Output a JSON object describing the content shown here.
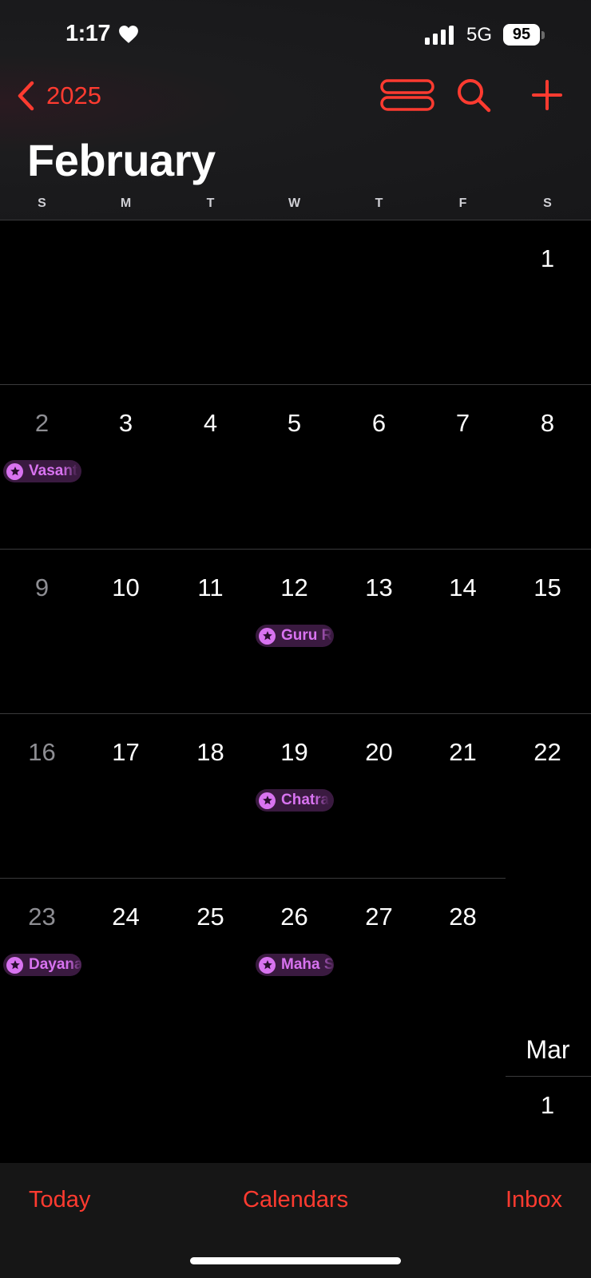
{
  "status_bar": {
    "time": "1:17",
    "network": "5G",
    "battery": "95"
  },
  "nav": {
    "back_label": "2025"
  },
  "month_title": "February",
  "weekdays": [
    "S",
    "M",
    "T",
    "W",
    "T",
    "F",
    "S"
  ],
  "weeks": [
    {
      "days": [
        "",
        "",
        "",
        "",
        "",
        "",
        "1"
      ]
    },
    {
      "days": [
        "2",
        "3",
        "4",
        "5",
        "6",
        "7",
        "8"
      ]
    },
    {
      "days": [
        "9",
        "10",
        "11",
        "12",
        "13",
        "14",
        "15"
      ]
    },
    {
      "days": [
        "16",
        "17",
        "18",
        "19",
        "20",
        "21",
        "22"
      ]
    },
    {
      "days": [
        "23",
        "24",
        "25",
        "26",
        "27",
        "28",
        ""
      ]
    }
  ],
  "events": [
    {
      "label": "Vasant",
      "day": "2"
    },
    {
      "label": "Guru R",
      "day": "12"
    },
    {
      "label": "Chatra",
      "day": "19"
    },
    {
      "label": "Dayana",
      "day": "23"
    },
    {
      "label": "Maha S",
      "day": "26"
    }
  ],
  "next_month": {
    "label": "Mar",
    "first_day": "1"
  },
  "tabbar": {
    "today": "Today",
    "calendars": "Calendars",
    "inbox": "Inbox"
  },
  "colors": {
    "accent": "#ff3b30",
    "event": "#d873f0",
    "event_bg": "#3a1a40",
    "background": "#000000"
  }
}
